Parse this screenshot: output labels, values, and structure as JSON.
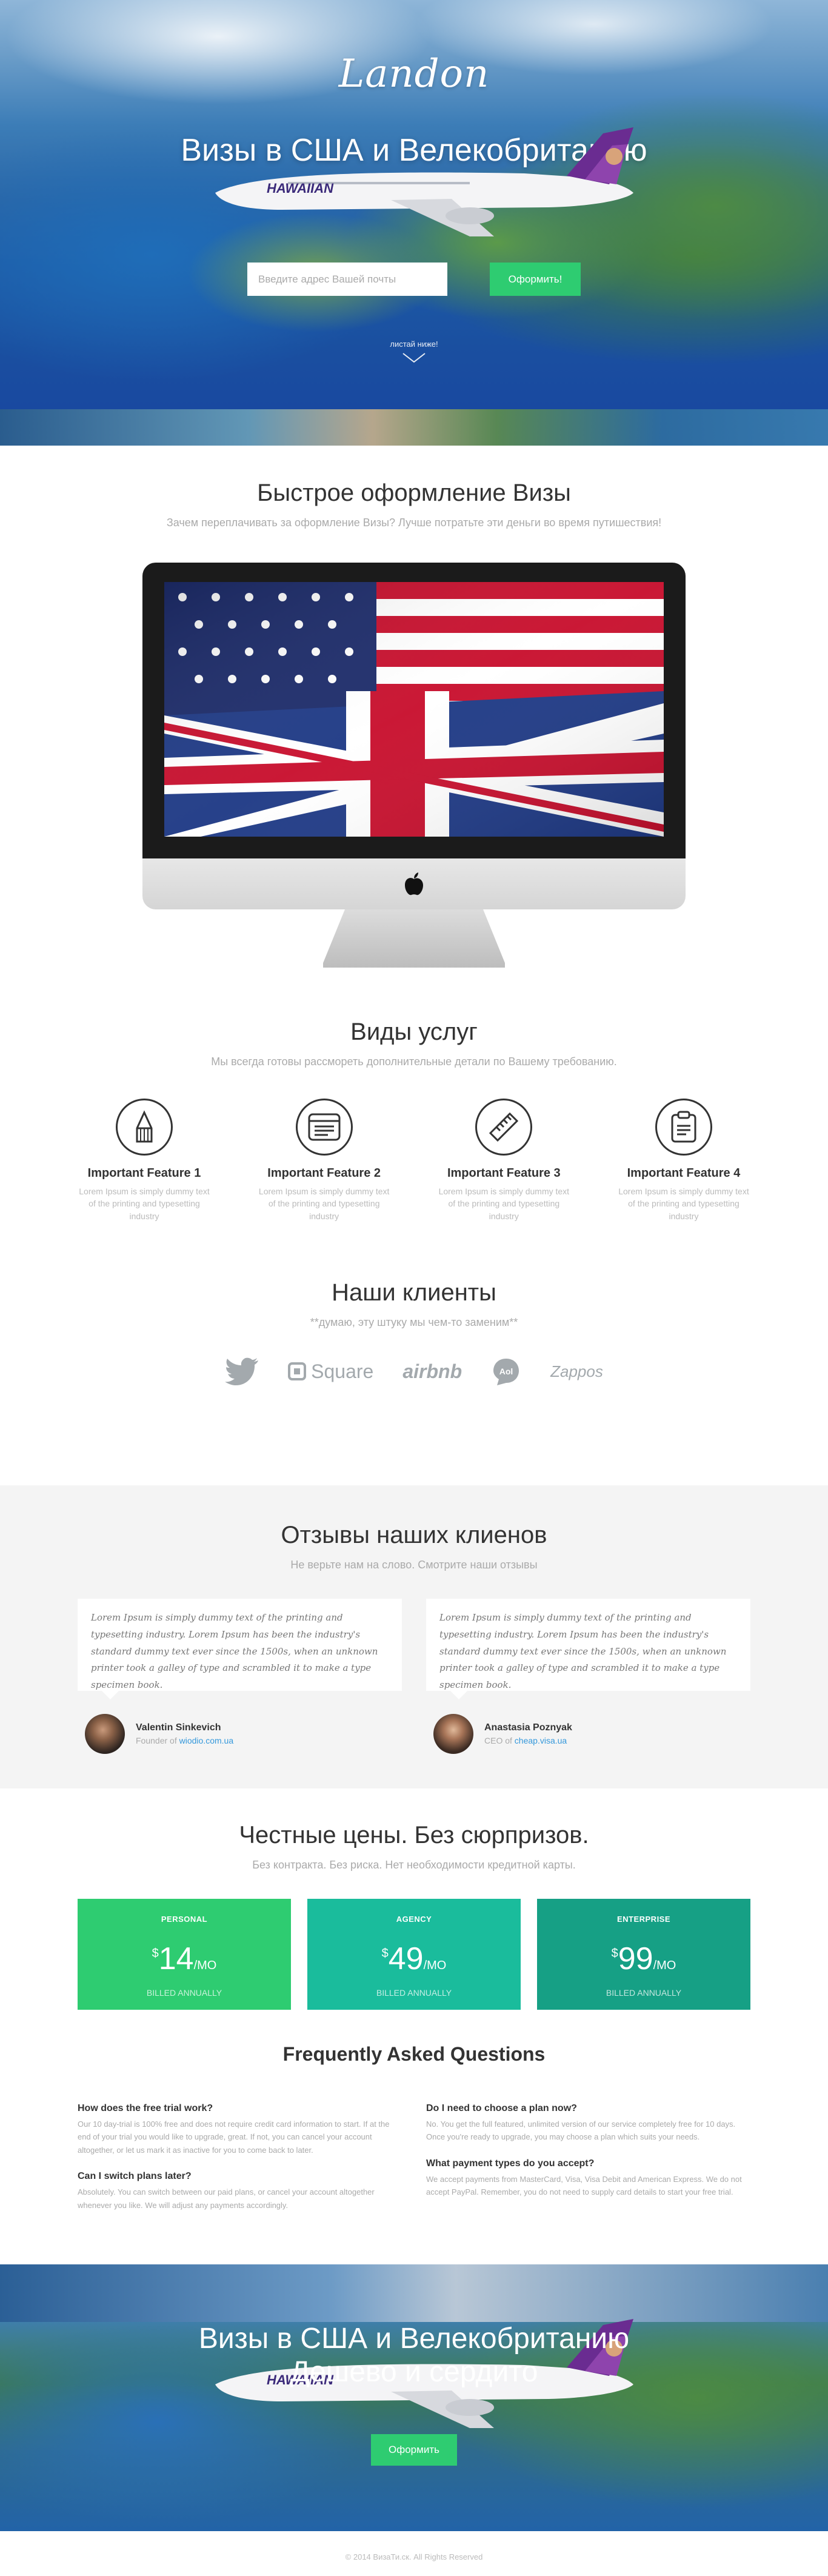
{
  "hero": {
    "logo": "Landon",
    "title": "Визы в США и Велекобританию",
    "airline": "HAWAIIAN",
    "email_placeholder": "Введите адрес Вашей почты",
    "submit_label": "Оформить!",
    "scroll_hint": "листай ниже!"
  },
  "visa": {
    "title": "Быстрое оформление Визы",
    "subtitle": "Зачем переплачивать за оформление Визы? Лучше потратьте эти деньги во время путишествия!"
  },
  "services": {
    "title": "Виды услуг",
    "subtitle": "Мы всегда готовы рассмореть дополнительные детали по Вашему требованию.",
    "features": [
      {
        "title": "Important Feature 1",
        "text": "Lorem Ipsum is simply dummy text of the printing and typesetting industry",
        "icon": "pencil-icon"
      },
      {
        "title": "Important Feature 2",
        "text": "Lorem Ipsum is simply dummy text of the printing and typesetting industry",
        "icon": "browser-window-icon"
      },
      {
        "title": "Important Feature 3",
        "text": "Lorem Ipsum is simply dummy text of the printing and typesetting industry",
        "icon": "ruler-icon"
      },
      {
        "title": "Important Feature 4",
        "text": "Lorem Ipsum is simply dummy text of the printing and typesetting industry",
        "icon": "clipboard-icon"
      }
    ]
  },
  "clients": {
    "title": "Наши клиенты",
    "subtitle": "**думаю, эту штуку мы чем-то заменим**",
    "logos": [
      "twitter-logo",
      "Square",
      "airbnb",
      "Aol",
      "Zappos"
    ]
  },
  "testimonials": {
    "title": "Отзывы наших клиенов",
    "subtitle": "Не верьте нам на слово. Смотрите наши отзывы",
    "items": [
      {
        "quote": "Lorem Ipsum is simply dummy text of the printing and typesetting industry. Lorem Ipsum has been the industry's standard dummy text ever since the 1500s, when an unknown printer took a galley of type and scrambled it to make a type specimen book.",
        "name": "Valentin Sinkevich",
        "role": "Founder of",
        "site": "wiodio.com.ua"
      },
      {
        "quote": "Lorem Ipsum is simply dummy text of the printing and typesetting industry. Lorem Ipsum has been the industry's standard dummy text ever since the 1500s, when an unknown printer took a galley of type and scrambled it to make a type specimen book.",
        "name": "Anastasia Poznyak",
        "role": "CEO of",
        "site": "cheap.visa.ua"
      }
    ]
  },
  "pricing": {
    "title": "Честные цены. Без сюрпризов.",
    "subtitle": "Без контракта. Без риска. Нет необходимости кредитной карты.",
    "plans": [
      {
        "name": "PERSONAL",
        "currency": "$",
        "price": "14",
        "period": "/MO",
        "billing": "BILLED ANNUALLY",
        "color": "#2ecc71"
      },
      {
        "name": "AGENCY",
        "currency": "$",
        "price": "49",
        "period": "/MO",
        "billing": "BILLED ANNUALLY",
        "color": "#1abc9c"
      },
      {
        "name": "ENTERPRISE",
        "currency": "$",
        "price": "99",
        "period": "/MO",
        "billing": "BILLED ANNUALLY",
        "color": "#16a085"
      }
    ]
  },
  "faq": {
    "title": "Frequently Asked Questions",
    "left": [
      {
        "q": "How does the free trial work?",
        "a": "Our 10 day-trial is 100% free and does not require credit card information to start. If at the end of your trial you would like to upgrade, great. If not, you can cancel your account altogether, or let us mark it as inactive for you to come back to later."
      },
      {
        "q": "Can I switch plans later?",
        "a": "Absolutely. You can switch between our paid plans, or cancel your account altogether whenever you like. We will adjust any payments accordingly."
      }
    ],
    "right": [
      {
        "q": "Do I need to choose a plan now?",
        "a": "No. You get the full featured, unlimited version of our service completely free for 10 days. Once you're ready to upgrade, you may choose a plan which suits your needs."
      },
      {
        "q": "What payment types do you accept?",
        "a": "We accept payments from MasterCard, Visa, Visa Debit and American Express. We do not accept PayPal. Remember, you do not need to supply card details to start your free trial."
      }
    ]
  },
  "cta": {
    "title": "Визы в США и Велекобританию",
    "subtitle": "Дешево и сердито",
    "button": "Оформить"
  },
  "footer": {
    "copyright": "© 2014 ВизаТи.ск. All Rights Reserved"
  },
  "colors": {
    "accent": "#2ecc71",
    "link": "#3498db"
  }
}
